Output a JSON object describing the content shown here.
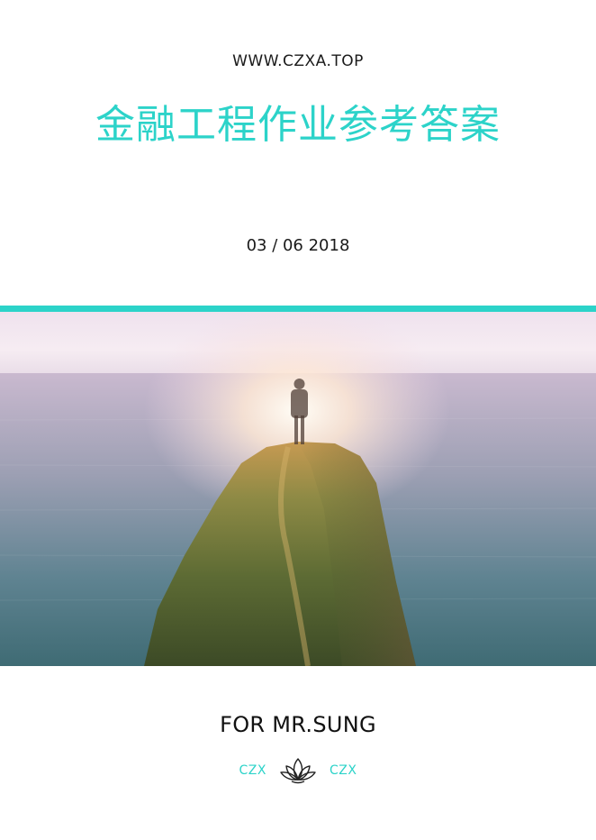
{
  "header": {
    "site_url": "WWW.CZXA.TOP",
    "title": "金融工程作业参考答案",
    "date": "03 / 06 2018"
  },
  "cover_image": {
    "subject": "person-on-cliff-over-sea"
  },
  "footer": {
    "recipient": "FOR MR.SUNG",
    "left_tag": "CZX",
    "right_tag": "CZX",
    "emblem_icon": "lotus-icon"
  },
  "colors": {
    "accent": "#2cd3c9",
    "text": "#1a1a1a",
    "background": "#ffffff"
  }
}
